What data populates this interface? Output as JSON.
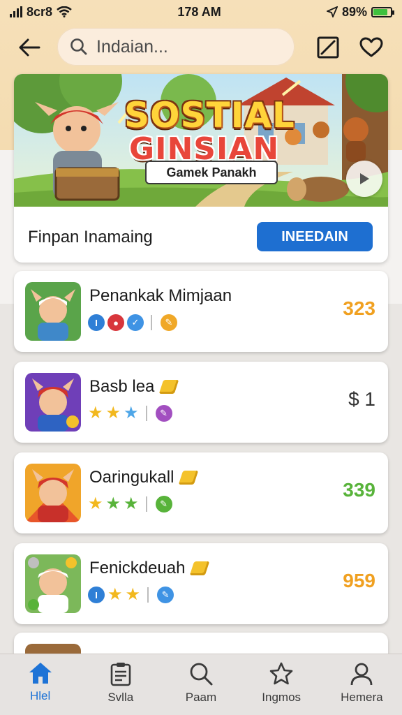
{
  "status_bar": {
    "carrier": "8cr8",
    "time": "178 AM",
    "battery": "89%"
  },
  "header": {
    "search_text": "Indaian..."
  },
  "banner": {
    "title_line1": "SOSTIAL",
    "title_line2": "GINSIAN",
    "subtitle": "Gamek Panakh",
    "label": "Finpan Inamaing",
    "button_label": "INEEDAIN"
  },
  "games": [
    {
      "name": "Penankak Mimjaan",
      "value": "323",
      "value_color": "#f0a020"
    },
    {
      "name": "Basb lea",
      "value": "$ 1",
      "value_color": "#333333"
    },
    {
      "name": "Oaringukall",
      "value": "339",
      "value_color": "#58b33a"
    },
    {
      "name": "Fenickdeuah",
      "value": "959",
      "value_color": "#f0a020"
    }
  ],
  "nav": [
    {
      "label": "Hlel",
      "icon": "home-icon",
      "active": true
    },
    {
      "label": "Svlla",
      "icon": "clipboard-icon",
      "active": false
    },
    {
      "label": "Paam",
      "icon": "search-icon",
      "active": false
    },
    {
      "label": "Ingmos",
      "icon": "star-icon",
      "active": false
    },
    {
      "label": "Hemera",
      "icon": "profile-icon",
      "active": false
    }
  ]
}
